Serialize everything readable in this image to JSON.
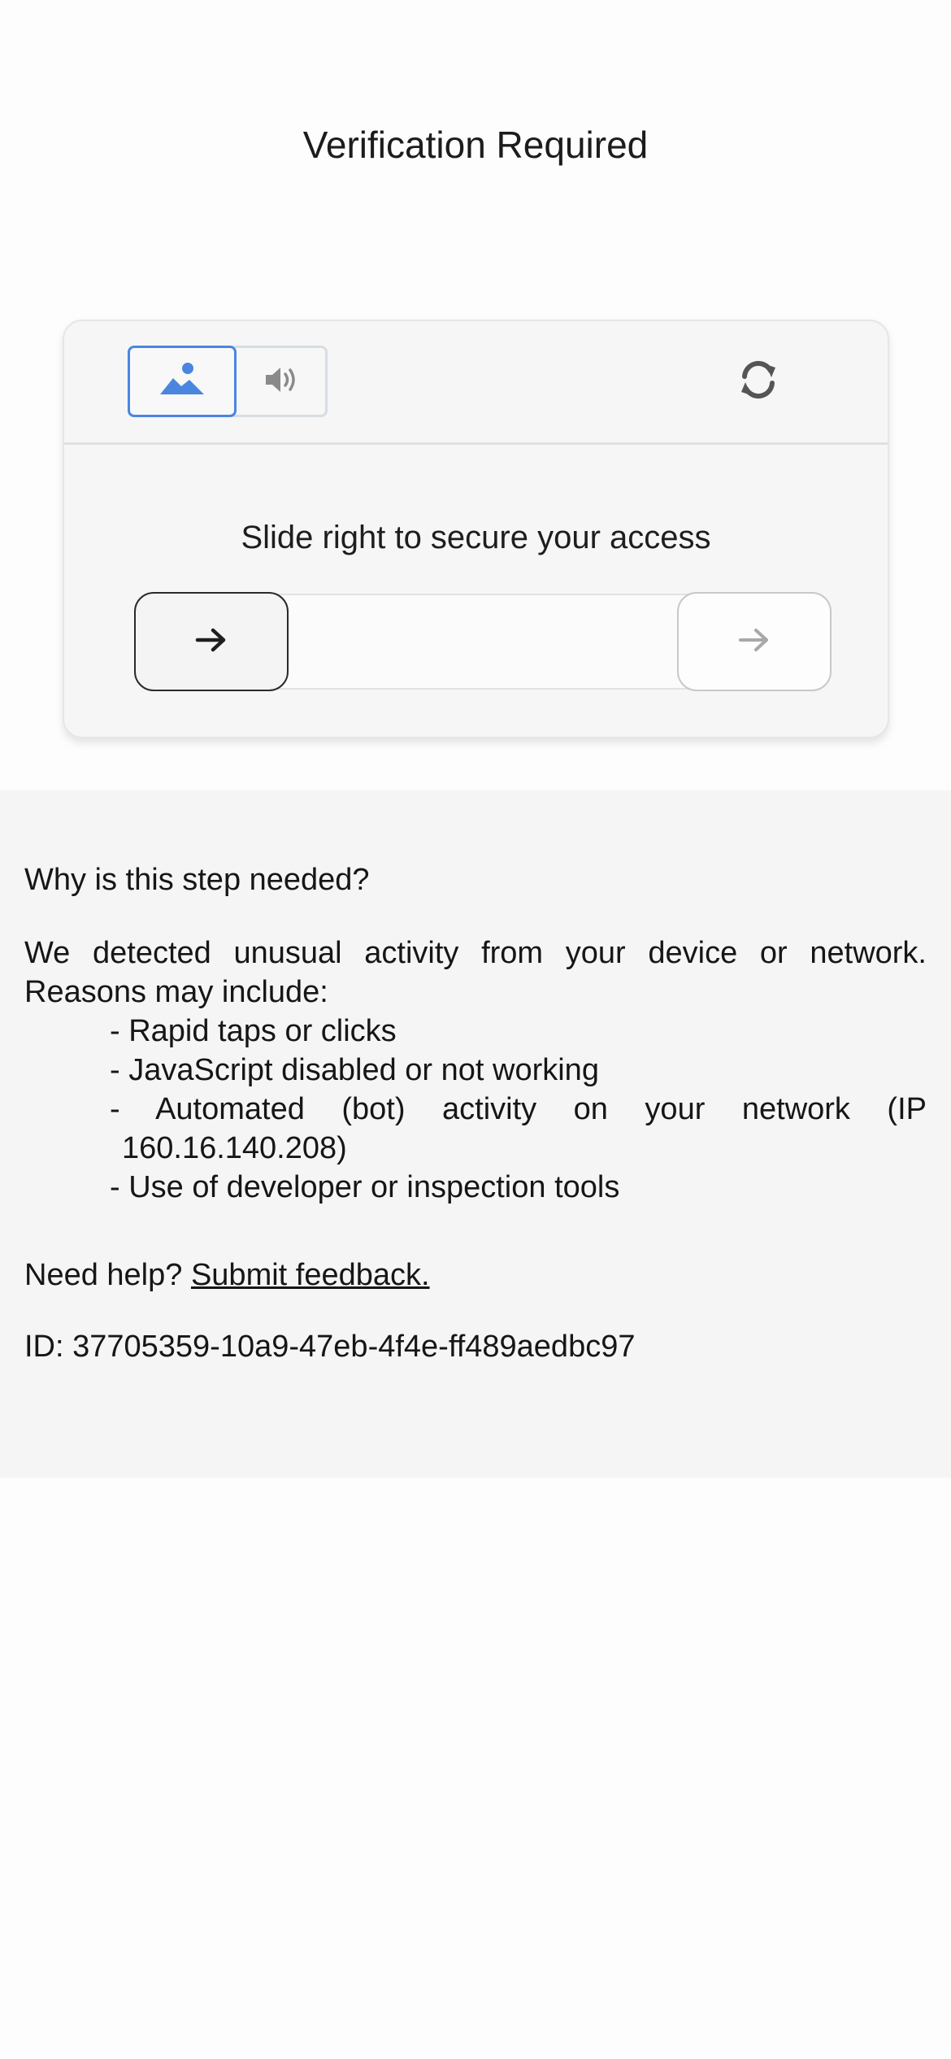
{
  "page": {
    "title": "Verification Required"
  },
  "captcha": {
    "modes": [
      {
        "name": "image",
        "icon": "image-icon",
        "selected": true
      },
      {
        "name": "audio",
        "icon": "audio-icon",
        "selected": false
      }
    ],
    "refresh_icon": "refresh-icon",
    "instruction": "Slide right to secure your access",
    "slider": {
      "handle_icon": "arrow-right-icon",
      "target_icon": "arrow-right-icon",
      "progress": 0
    }
  },
  "info": {
    "heading": "Why is this step needed?",
    "intro": "We detected unusual activity from your device or network. Reasons may include:",
    "reasons": [
      "- Rapid taps or clicks",
      "- JavaScript disabled or not working",
      "- Automated (bot) activity on your network (IP 160.16.140.208)",
      "- Use of developer or inspection tools"
    ],
    "help_prefix": "Need help?",
    "help_link": "Submit feedback.",
    "id_text": "ID: 37705359-10a9-47eb-4f4e-ff489aedbc97"
  },
  "colors": {
    "accent": "#4a86e0",
    "panel_background": "#f5f5f5",
    "card_background": "#f6f6f6"
  }
}
